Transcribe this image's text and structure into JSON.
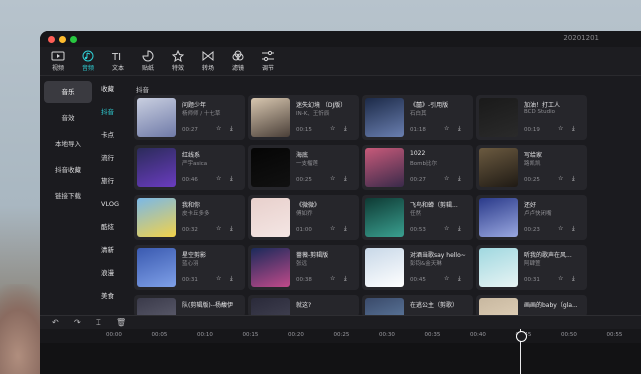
{
  "window": {
    "title": "20201201"
  },
  "toolbar": {
    "tools": [
      {
        "label": "视频",
        "icon": "video-icon"
      },
      {
        "label": "音频",
        "icon": "audio-icon"
      },
      {
        "label": "文本",
        "icon": "text-icon"
      },
      {
        "label": "贴纸",
        "icon": "sticker-icon"
      },
      {
        "label": "特效",
        "icon": "effect-icon"
      },
      {
        "label": "转场",
        "icon": "transition-icon"
      },
      {
        "label": "滤镜",
        "icon": "filter-icon"
      },
      {
        "label": "调节",
        "icon": "adjust-icon"
      }
    ]
  },
  "sidebar": {
    "items": [
      {
        "label": "音乐"
      },
      {
        "label": "音效"
      },
      {
        "label": "本地导入"
      },
      {
        "label": "抖音收藏"
      },
      {
        "label": "链接下载"
      }
    ]
  },
  "categories": [
    "收藏",
    "抖音",
    "卡点",
    "流行",
    "旅行",
    "VLOG",
    "酷炫",
    "清新",
    "浪漫",
    "美食",
    "治愈"
  ],
  "grid": {
    "title": "抖音",
    "cards": [
      {
        "title": "问题少年",
        "artist": "杨师师 / 十七草",
        "duration": "00:27"
      },
      {
        "title": "迷失幻境 （DJ版）",
        "artist": "IN-K、王忻辰",
        "duration": "00:15"
      },
      {
        "title": "《囍》-引用版",
        "artist": "石白其",
        "duration": "01:18"
      },
      {
        "title": "加油！打工人",
        "artist": "BCD Studio",
        "duration": "00:19"
      },
      {
        "title": "红线系",
        "artist": "严宇asica",
        "duration": "00:46"
      },
      {
        "title": "海底",
        "artist": "一支榴莲",
        "duration": "00:25"
      },
      {
        "title": "1022",
        "artist": "Bomb比尔",
        "duration": "00:27"
      },
      {
        "title": "写给家",
        "artist": "路凯凯",
        "duration": "00:25"
      },
      {
        "title": "我和你",
        "artist": "皮卡丘多多",
        "duration": "00:32"
      },
      {
        "title": "《微微》",
        "artist": "傅如乔",
        "duration": "01:00"
      },
      {
        "title": "飞鸟和蝉（剪辑...",
        "artist": "任然",
        "duration": "00:53"
      },
      {
        "title": "还好",
        "artist": "卢卢快闭嘴",
        "duration": "00:23"
      },
      {
        "title": "星空剪影",
        "artist": "蓝心羽",
        "duration": "00:31"
      },
      {
        "title": "蔷薇-剪辑版",
        "artist": "张远",
        "duration": "00:38"
      },
      {
        "title": "对酒当歌say hello~",
        "artist": "彭钧&金天琳",
        "duration": "00:45"
      },
      {
        "title": "听我的歌声在风...",
        "artist": "阿肆萱",
        "duration": "00:31"
      },
      {
        "title": "队(剪辑版)--杨馥伊",
        "artist": "",
        "duration": ""
      },
      {
        "title": "就这?",
        "artist": "",
        "duration": ""
      },
      {
        "title": "在逃公主（剪歌）",
        "artist": "",
        "duration": ""
      },
      {
        "title": "画画的baby（gla...",
        "artist": "",
        "duration": ""
      }
    ]
  },
  "timeline": {
    "ticks": [
      "00:00",
      "00:05",
      "00:10",
      "00:15",
      "00:20",
      "00:25",
      "00:30",
      "00:35",
      "00:40",
      "00:45",
      "00:50",
      "00:55"
    ]
  },
  "colors": {
    "accent": "#2fd0d6",
    "background": "#1b1b1f",
    "card": "#26262b"
  }
}
